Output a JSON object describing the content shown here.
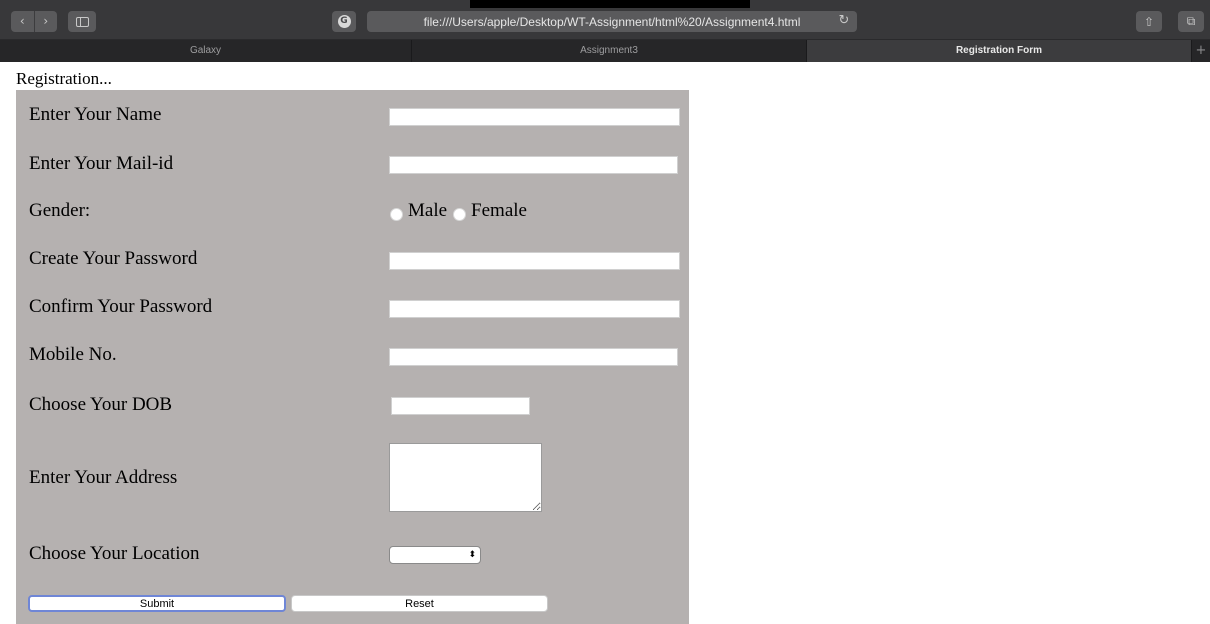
{
  "browser": {
    "nav_back": "‹",
    "nav_forward": "›",
    "extension_icon": "G",
    "url": "file:///Users/apple/Desktop/WT-Assignment/html%20/Assignment4.html",
    "reload_icon": "↻",
    "share_icon": "⇧",
    "tabs_icon": "⧉",
    "tabs": [
      {
        "label": "Galaxy"
      },
      {
        "label": "Assignment3"
      },
      {
        "label": "Registration Form"
      }
    ],
    "new_tab": "+"
  },
  "page": {
    "heading": "Registration...",
    "form": {
      "name_label": "Enter Your Name",
      "mail_label": "Enter Your Mail-id",
      "gender_label": "Gender:",
      "gender_options": [
        "Male",
        "Female"
      ],
      "password_label": "Create Your Password",
      "confirm_label": "Confirm Your Password",
      "mobile_label": "Mobile No.",
      "dob_label": "Choose Your DOB",
      "address_label": "Enter Your Address",
      "location_label": "Choose Your Location",
      "submit_label": "Submit",
      "reset_label": "Reset"
    }
  },
  "colors": {
    "panel": "#b5b1b0",
    "focus_ring": "#6f86d6",
    "chrome": "#38383a"
  }
}
